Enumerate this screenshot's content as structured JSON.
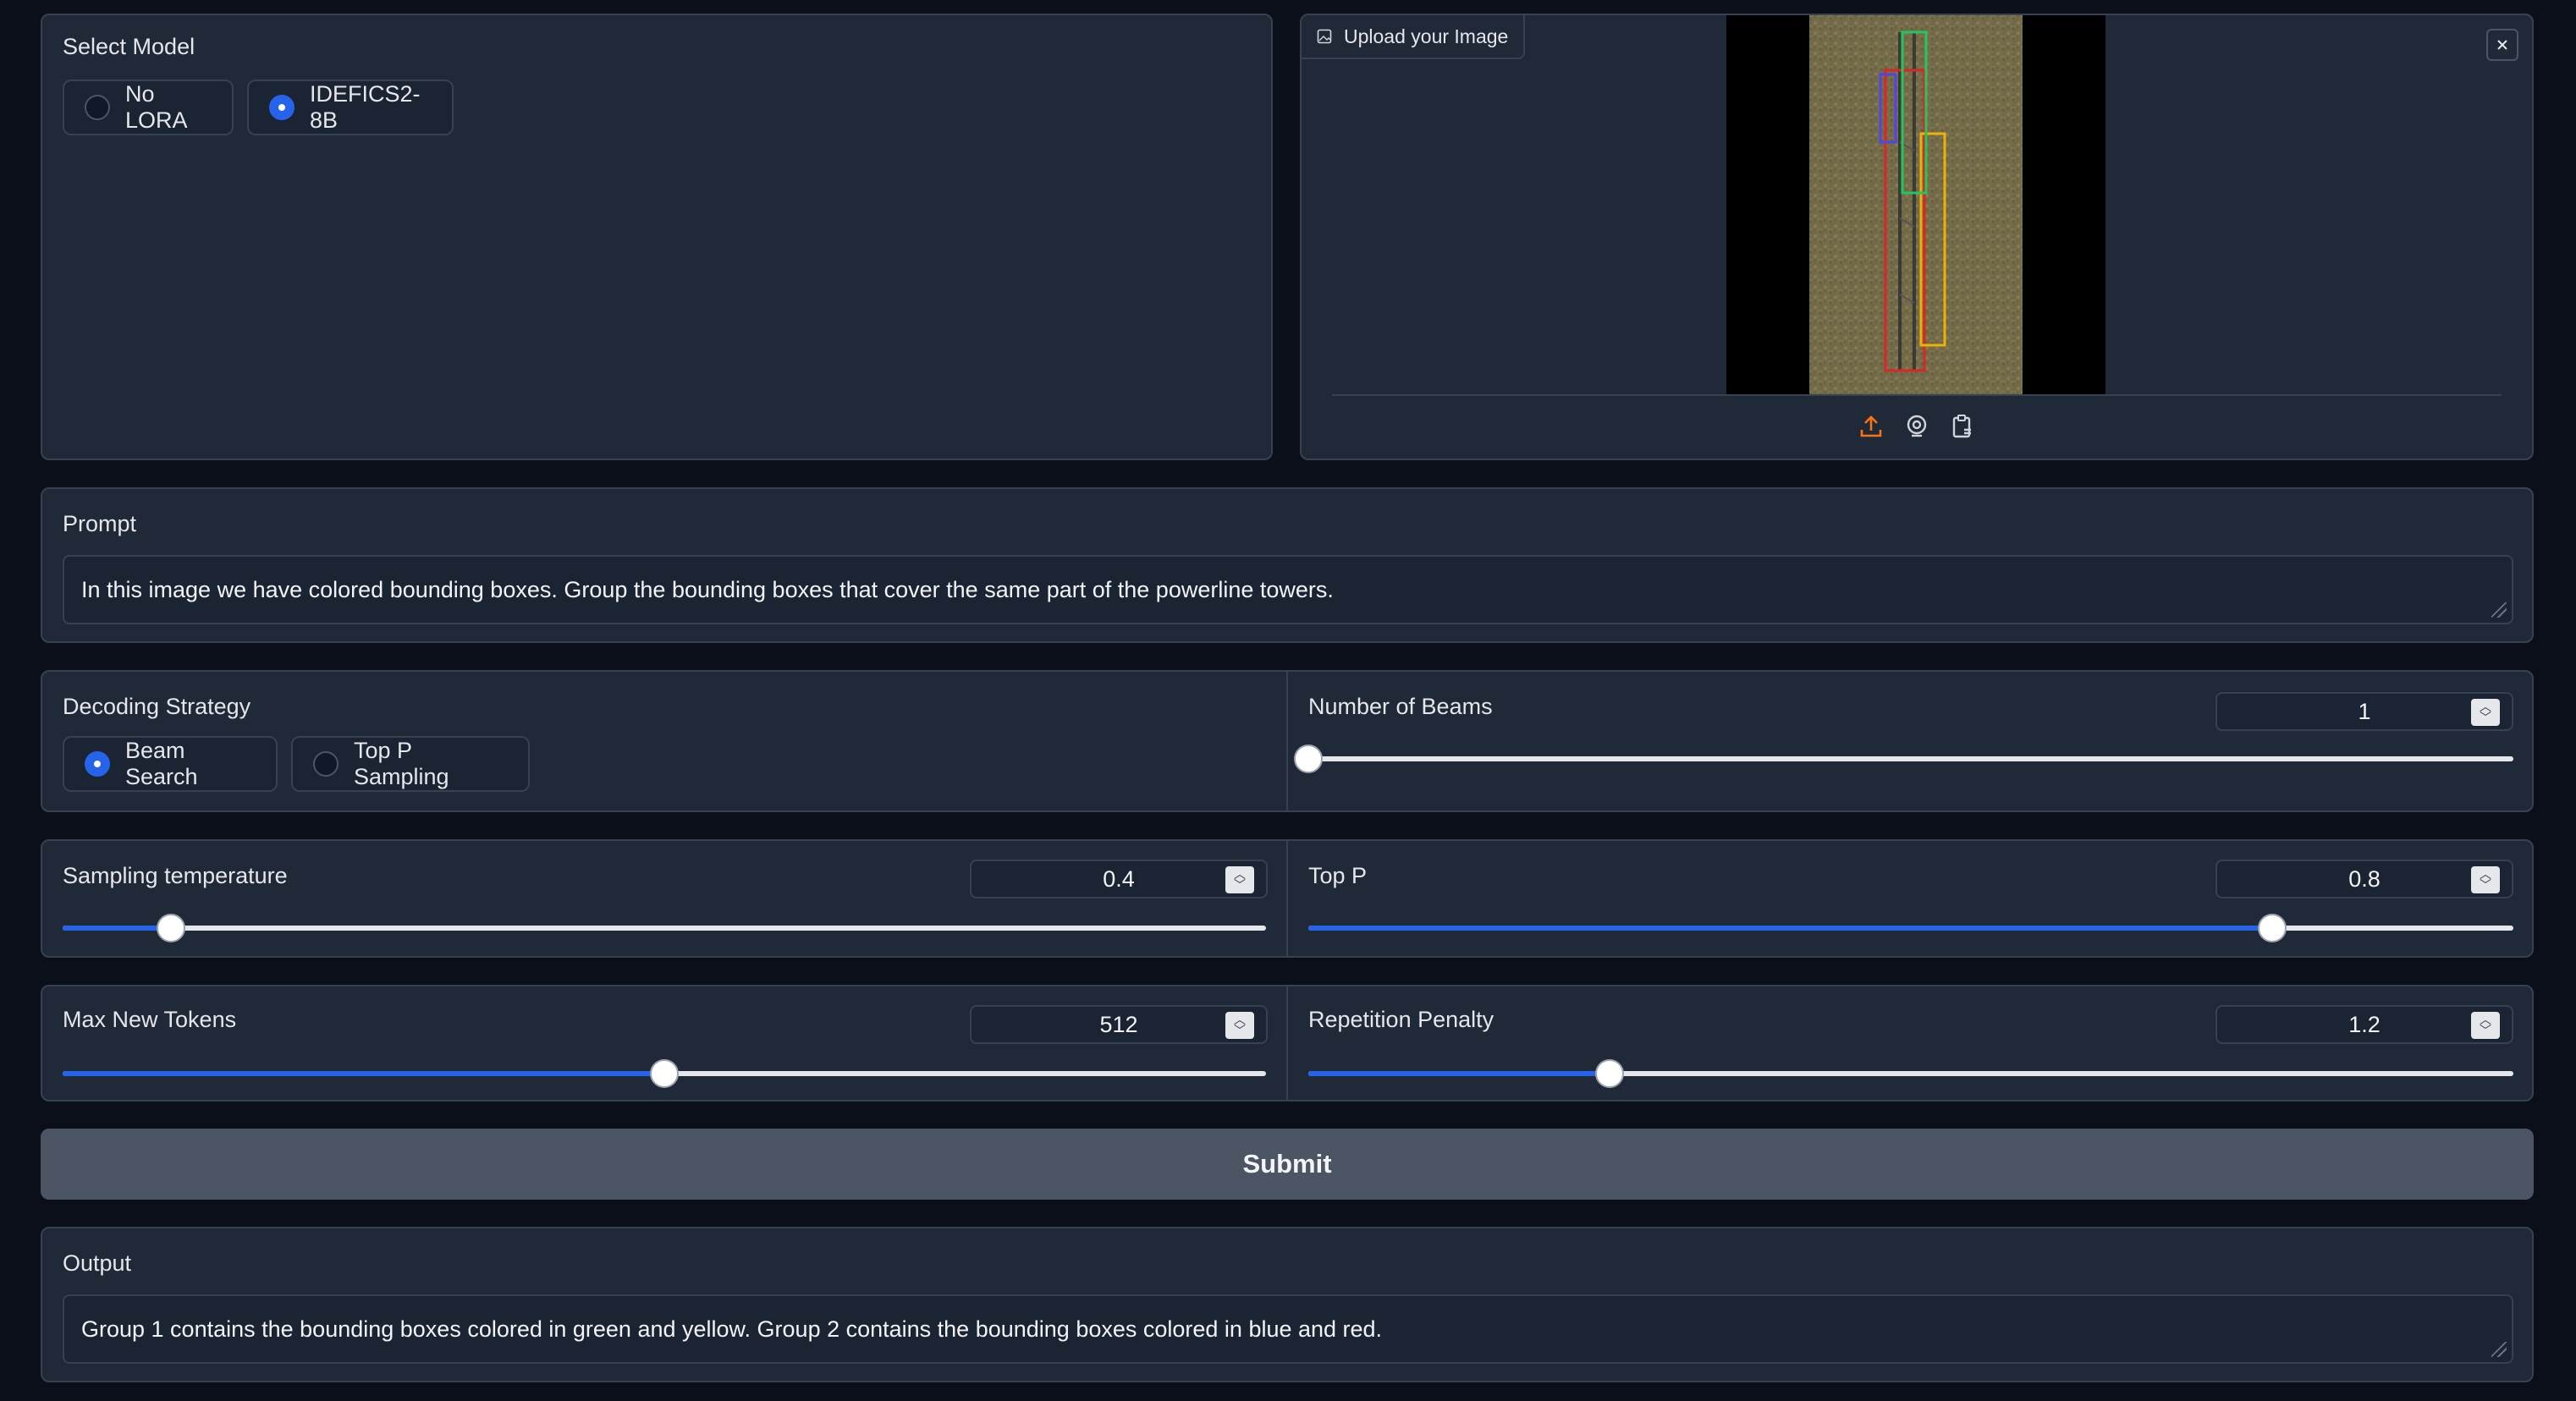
{
  "model": {
    "label": "Select Model",
    "options": [
      "No LORA",
      "IDEFICS2-8B"
    ],
    "selected": "IDEFICS2-8B"
  },
  "image_upload": {
    "label": "Upload your Image",
    "clear_icon": "close-icon",
    "toolbar_icons": [
      "upload-icon",
      "webcam-icon",
      "clipboard-icon"
    ],
    "accent": "#f97316"
  },
  "prompt": {
    "label": "Prompt",
    "value": "In this image we have colored bounding boxes. Group the bounding boxes that cover the same part of the powerline towers."
  },
  "decoding": {
    "label": "Decoding Strategy",
    "options": [
      "Beam Search",
      "Top P Sampling"
    ],
    "selected": "Beam Search"
  },
  "sliders": {
    "num_beams": {
      "label": "Number of Beams",
      "value": "1",
      "fraction": 0.0
    },
    "temperature": {
      "label": "Sampling temperature",
      "value": "0.4",
      "fraction": 0.09
    },
    "top_p": {
      "label": "Top P",
      "value": "0.8",
      "fraction": 0.8
    },
    "max_new_tokens": {
      "label": "Max New Tokens",
      "value": "512",
      "fraction": 0.5
    },
    "repetition_penalty": {
      "label": "Repetition Penalty",
      "value": "1.2",
      "fraction": 0.25
    }
  },
  "submit": {
    "label": "Submit"
  },
  "output": {
    "label": "Output",
    "value": "Group 1 contains the bounding boxes colored in green and yellow. Group 2 contains the bounding boxes colored in blue and red."
  },
  "colors": {
    "accent": "#2563eb",
    "panel": "#1f2937",
    "background": "#0b0f19"
  }
}
